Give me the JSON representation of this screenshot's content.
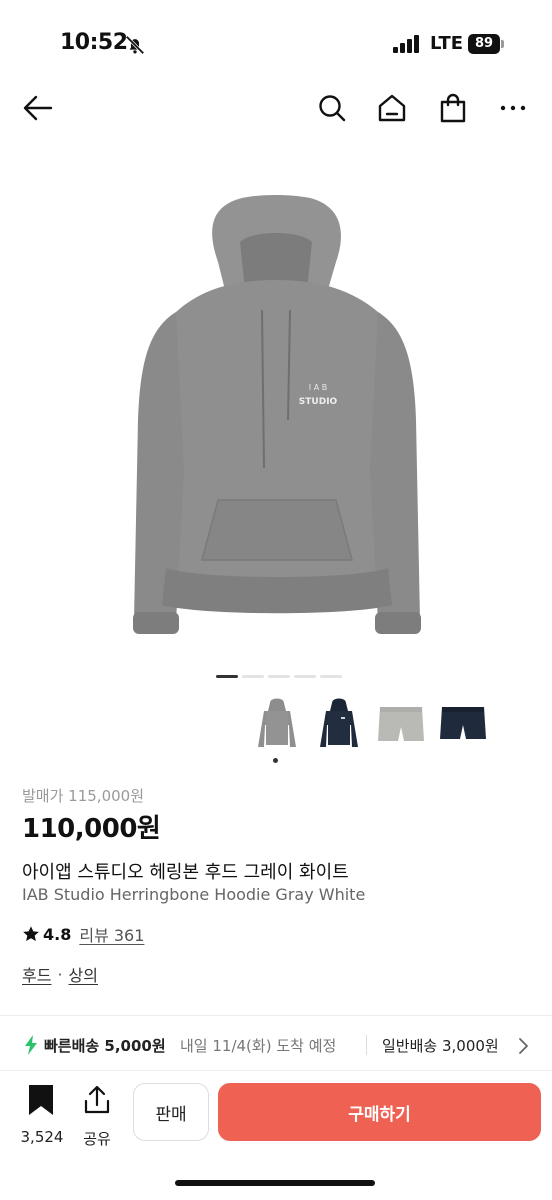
{
  "status_bar": {
    "time": "10:52",
    "network": "LTE",
    "battery": "89"
  },
  "nav": {
    "icons": [
      "back-arrow-icon",
      "search-icon",
      "home-icon",
      "shopping-bag-icon",
      "more-icon"
    ]
  },
  "gallery": {
    "page_count": 5,
    "active_page": 1,
    "thumbnails": [
      "gray-hoodie",
      "navy-hoodie",
      "gray-shorts",
      "navy-shorts"
    ],
    "selected_thumbnail": 1,
    "print_text": [
      "I A B",
      "STUDIO"
    ]
  },
  "product": {
    "original_price": "발매가 115,000원",
    "price": "110,000원",
    "title_ko": "아이앱 스튜디오 헤링본 후드 그레이 화이트",
    "title_en": "IAB Studio Herringbone Hoodie Gray White",
    "rating": "4.8",
    "review_label": "리뷰 361",
    "category_main": "후드",
    "category_sep": "·",
    "category_sub": "상의"
  },
  "shipping": {
    "fast_label": "빠른배송 5,000원",
    "fast_eta": "내일 11/4(화) 도착 예정",
    "normal_label": "일반배송 3,000원"
  },
  "actions": {
    "bookmark_count": "3,524",
    "share_label": "공유",
    "sell_label": "판매",
    "buy_label": "구매하기"
  },
  "colors": {
    "buy_button": "#ef6253",
    "bolt": "#2bc26b",
    "hoodie_gray": "#8f8f8f",
    "navy": "#1f2a3d"
  }
}
